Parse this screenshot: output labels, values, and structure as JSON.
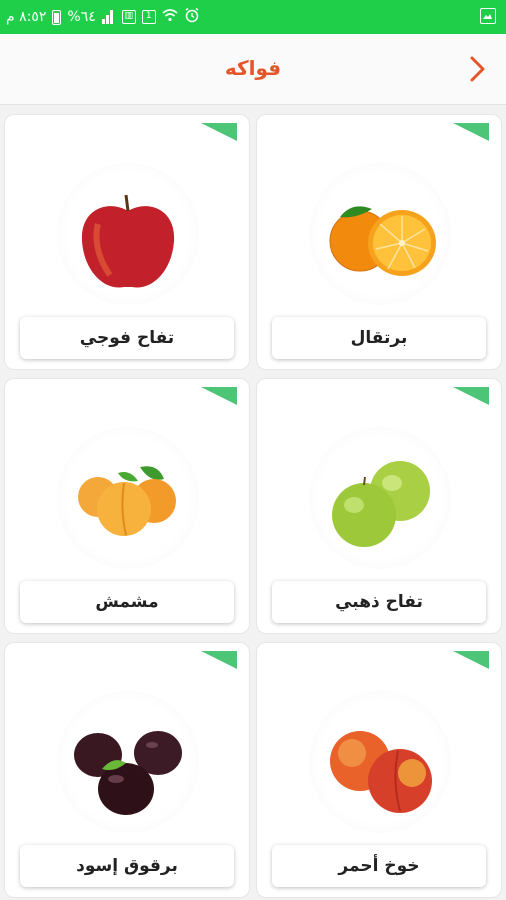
{
  "status_bar": {
    "time": "٨:٥٢ م",
    "battery_percent": "%٦٤",
    "icons": [
      "battery-icon",
      "signal-icon",
      "sim1-icon",
      "data-icon",
      "wifi-icon",
      "alarm-icon",
      "gallery-icon"
    ]
  },
  "header": {
    "title": "فواكه",
    "back_icon": "chevron-right-icon",
    "accent_color": "#e2562a"
  },
  "fruits": [
    {
      "name": "برتقال",
      "icon": "orange-fruit"
    },
    {
      "name": "تفاح فوجي",
      "icon": "red-apple-fruit"
    },
    {
      "name": "تفاح ذهبي",
      "icon": "green-apple-fruit"
    },
    {
      "name": "مشمش",
      "icon": "apricot-fruit"
    },
    {
      "name": "خوخ أحمر",
      "icon": "peach-fruit"
    },
    {
      "name": "برقوق إسود",
      "icon": "plum-fruit"
    }
  ],
  "colors": {
    "status_bar": "#1fcf4a",
    "corner_tag": "#4cc577"
  }
}
